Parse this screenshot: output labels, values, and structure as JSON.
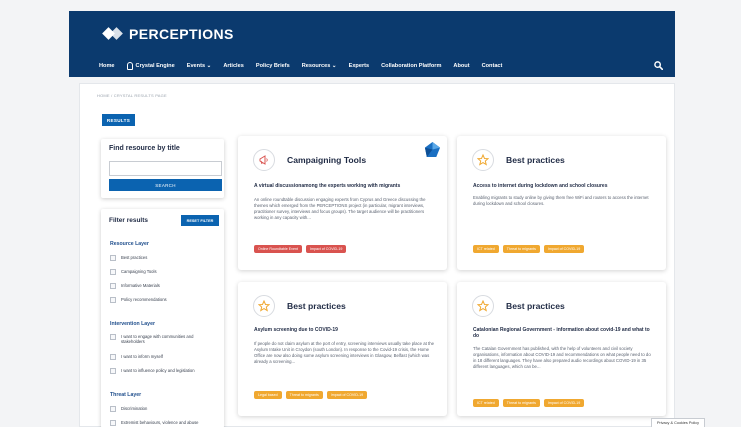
{
  "header": {
    "brand": "PERCEPTIONS",
    "nav": [
      {
        "label": "Home"
      },
      {
        "label": "Crystal Engine"
      },
      {
        "label": "Events ⌄"
      },
      {
        "label": "Articles"
      },
      {
        "label": "Policy Briefs"
      },
      {
        "label": "Resources ⌄"
      },
      {
        "label": "Experts"
      },
      {
        "label": "Collaboration Platform"
      },
      {
        "label": "About"
      },
      {
        "label": "Contact"
      }
    ],
    "search_icon": "search-icon"
  },
  "breadcrumb": "HOME  /  CRYSTAL RESULTS PAGE",
  "results_label": "RESULTS",
  "find": {
    "title": "Find resource by title",
    "value": "",
    "button": "SEARCH"
  },
  "filters": {
    "title": "Filter results",
    "reset": "RESET FILTER",
    "groups": [
      {
        "title": "Resource Layer",
        "options": [
          "Best practices",
          "Campaigning Tools",
          "Informative Materials",
          "Policy recommendations"
        ]
      },
      {
        "title": "Intervention Layer",
        "options": [
          "I want to engage with communities and stakeholders",
          "I want to inform myself",
          "I want to influence policy and legislation"
        ]
      },
      {
        "title": "Threat Layer",
        "options": [
          "Discrimination",
          "Extremist behaviours, violence and abuse"
        ]
      }
    ]
  },
  "cards": [
    {
      "type": "Campaigning Tools",
      "icon": "megaphone-icon",
      "title": "A virtual discussionamong the experts working with migrants",
      "desc": "An online roundtable discussion engaging experts from Cyprus and Greece discussing the themes which emerged from the PERCEPTIONS project (in particular, migrant interviews, practitioner survey, interviews and focus groups). The target audience will be practitioners working in any capacity with...",
      "tags": [
        {
          "label": "Online Roundtable Event",
          "color": "red"
        },
        {
          "label": "Impact of COVID-19",
          "color": "red"
        }
      ]
    },
    {
      "type": "Best practices",
      "icon": "star-icon",
      "title": "Access to internet during lockdown and school closures",
      "desc": "Enabling migrants to study online by giving them free WiFi and routers to access the internet during lockdown and school closures.",
      "tags": [
        {
          "label": "ICT related",
          "color": "orange"
        },
        {
          "label": "Threat to migrants",
          "color": "orange"
        },
        {
          "label": "Impact of COVID-19",
          "color": "orange"
        }
      ]
    },
    {
      "type": "Best practices",
      "icon": "star-icon",
      "title": "Asylum screening due to COVID-19",
      "desc": "If people do not claim asylum at the port of entry, screening interviews usually take place at the Asylum Intake Unit in Croydon (south London). In response to the Covid-19 crisis, the Home Office are now also doing some asylum screening interviews in Glasgow, Belfast (which was already a screening...",
      "tags": [
        {
          "label": "Legal based",
          "color": "orange"
        },
        {
          "label": "Threat to migrants",
          "color": "orange"
        },
        {
          "label": "Impact of COVID-19",
          "color": "orange"
        }
      ]
    },
    {
      "type": "Best practices",
      "icon": "star-icon",
      "title": "Catalonian Regional Government - information about covid-19 and what to do",
      "desc": "The Catalan Government has published, with the help of volunteers and civil society organisations, information about COVID-19 and recommendations on what people need to do in 18 different languages. They have also prepared audio recordings about COVID-19 in 35 different languages, which can be...",
      "tags": [
        {
          "label": "ICT related",
          "color": "orange"
        },
        {
          "label": "Threat to migrants",
          "color": "orange"
        },
        {
          "label": "Impact of COVID-19",
          "color": "orange"
        }
      ]
    }
  ],
  "privacy": "Privacy & Cookies Policy",
  "colors": {
    "header": "#0b3a6e",
    "button": "#0b63b0",
    "tag_red": "#d9534f",
    "tag_orange": "#f0a830",
    "star": "#f0a830",
    "megaphone": "#d9534f"
  }
}
